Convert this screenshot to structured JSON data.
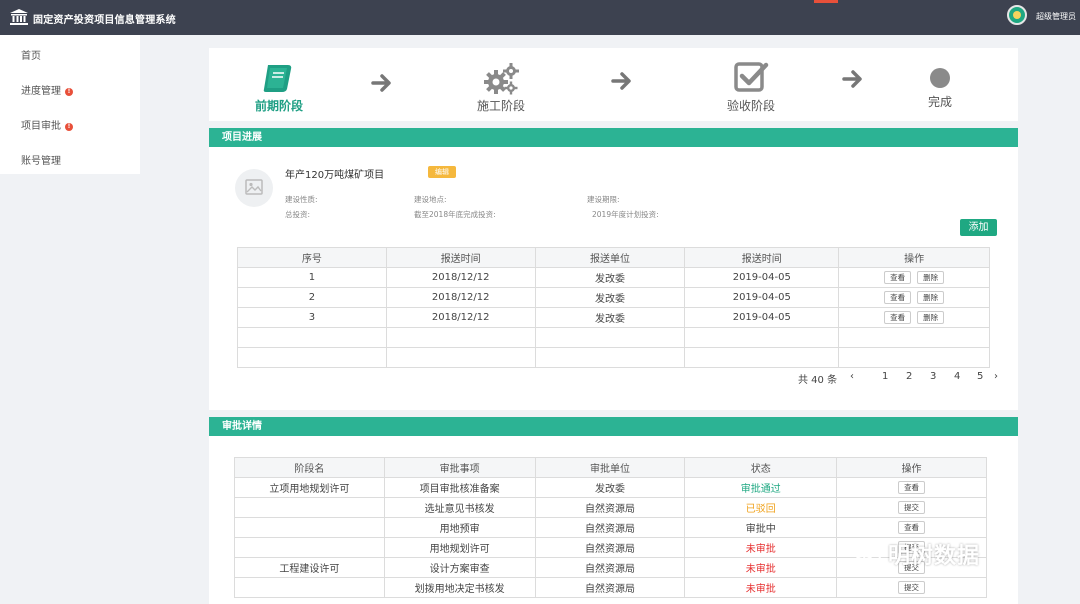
{
  "header": {
    "title": "固定资产投资项目信息管理系统",
    "user": "超级管理员"
  },
  "sidebar": {
    "items": [
      {
        "label": "首页",
        "alert": ""
      },
      {
        "label": "进度管理",
        "alert": "!"
      },
      {
        "label": "项目审批",
        "alert": "!"
      },
      {
        "label": "账号管理",
        "alert": ""
      }
    ]
  },
  "stages": [
    {
      "label": "前期阶段",
      "icon": "book-icon",
      "active": true
    },
    {
      "label": "施工阶段",
      "icon": "gears-icon",
      "active": false
    },
    {
      "label": "验收阶段",
      "icon": "checkbox-icon",
      "active": false
    },
    {
      "label": "完成",
      "icon": "circle-icon",
      "active": false
    }
  ],
  "progress": {
    "section_title": "项目进展",
    "project": {
      "name": "年产120万吨煤矿项目",
      "badge": "编辑",
      "nature": "建设性质:",
      "location": "建设地点:",
      "period": "建设期限:",
      "total": "总投资:",
      "done_by_2018": "截至2018年底完成投资:",
      "plan_2019": "2019年度计划投资:"
    },
    "add_label": "添加",
    "columns": [
      "序号",
      "报送时间",
      "报送单位",
      "报送时间",
      "操作"
    ],
    "rows": [
      {
        "no": "1",
        "time1": "2018/12/12",
        "unit": "发改委",
        "time2": "2019-04-05",
        "view": "查看",
        "del": "删除"
      },
      {
        "no": "2",
        "time1": "2018/12/12",
        "unit": "发改委",
        "time2": "2019-04-05",
        "view": "查看",
        "del": "删除"
      },
      {
        "no": "3",
        "time1": "2018/12/12",
        "unit": "发改委",
        "time2": "2019-04-05",
        "view": "查看",
        "del": "删除"
      },
      {
        "no": "",
        "time1": "",
        "unit": "",
        "time2": "",
        "view": "",
        "del": ""
      },
      {
        "no": "",
        "time1": "",
        "unit": "",
        "time2": "",
        "view": "",
        "del": ""
      }
    ],
    "pager": {
      "total": "共 40 条",
      "pages": [
        "1",
        "2",
        "3",
        "4",
        "5"
      ]
    }
  },
  "approval": {
    "section_title": "审批详情",
    "columns": [
      "阶段名",
      "审批事项",
      "审批单位",
      "状态",
      "操作"
    ],
    "rows": [
      {
        "phase": "立项用地规划许可",
        "item": "项目审批核准备案",
        "unit": "发改委",
        "status": "审批通过",
        "status_kind": "ok",
        "action": "查看"
      },
      {
        "phase": "",
        "item": "选址意见书核发",
        "unit": "自然资源局",
        "status": "已驳回",
        "status_kind": "back",
        "action": "提交"
      },
      {
        "phase": "",
        "item": "用地预审",
        "unit": "自然资源局",
        "status": "审批中",
        "status_kind": "mid",
        "action": "查看"
      },
      {
        "phase": "",
        "item": "用地规划许可",
        "unit": "自然资源局",
        "status": "未审批",
        "status_kind": "no",
        "action": "提交"
      },
      {
        "phase": "工程建设许可",
        "item": "设计方案审查",
        "unit": "自然资源局",
        "status": "未审批",
        "status_kind": "no",
        "action": "提交"
      },
      {
        "phase": "",
        "item": "划拨用地决定书核发",
        "unit": "自然资源局",
        "status": "未审批",
        "status_kind": "no",
        "action": "提交"
      }
    ]
  },
  "watermark": "明树数据",
  "colors": {
    "topbar": "#3d4250",
    "accent": "#2cb394",
    "alert": "#e8503a",
    "badge": "#f5b83d"
  }
}
